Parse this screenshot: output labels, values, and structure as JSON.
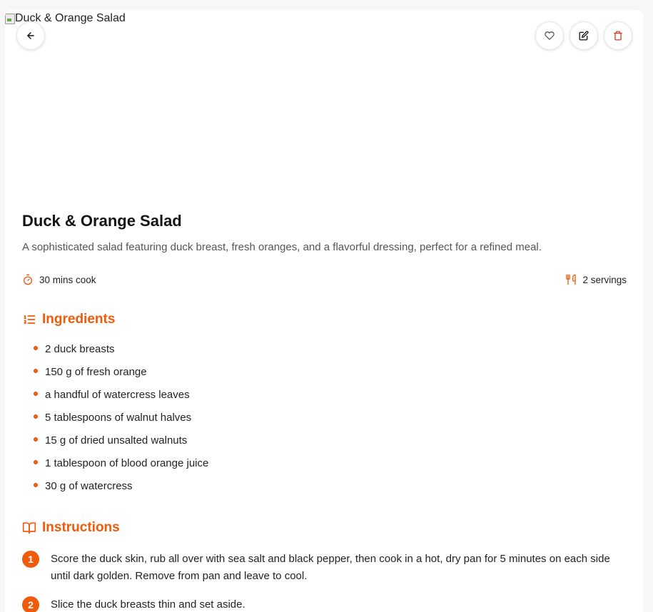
{
  "hero": {
    "alt_text": "Duck & Orange Salad"
  },
  "actions": {
    "back_icon": "arrow-left-icon",
    "favorite_icon": "heart-icon",
    "edit_icon": "edit-icon",
    "delete_icon": "trash-icon"
  },
  "recipe": {
    "title": "Duck & Orange Salad",
    "description": "A sophisticated salad featuring duck breast, fresh oranges, and a flavorful dressing, perfect for a refined meal.",
    "cook_time": "30 mins cook",
    "servings": "2 servings"
  },
  "ingredients": {
    "heading": "Ingredients",
    "items": [
      "2 duck breasts",
      "150 g of fresh orange",
      "a handful of watercress leaves",
      "5 tablespoons of walnut halves",
      "15 g of dried unsalted walnuts",
      "1 tablespoon of blood orange juice",
      "30 g of watercress"
    ]
  },
  "instructions": {
    "heading": "Instructions",
    "steps": [
      {
        "number": "1",
        "text": "Score the duck skin, rub all over with sea salt and black pepper, then cook in a hot, dry pan for 5 minutes on each side until dark golden. Remove from pan and leave to cool."
      },
      {
        "number": "2",
        "text": "Slice the duck breasts thin and set aside."
      }
    ]
  },
  "colors": {
    "accent": "#f05a0b",
    "delete": "#e0331f"
  }
}
